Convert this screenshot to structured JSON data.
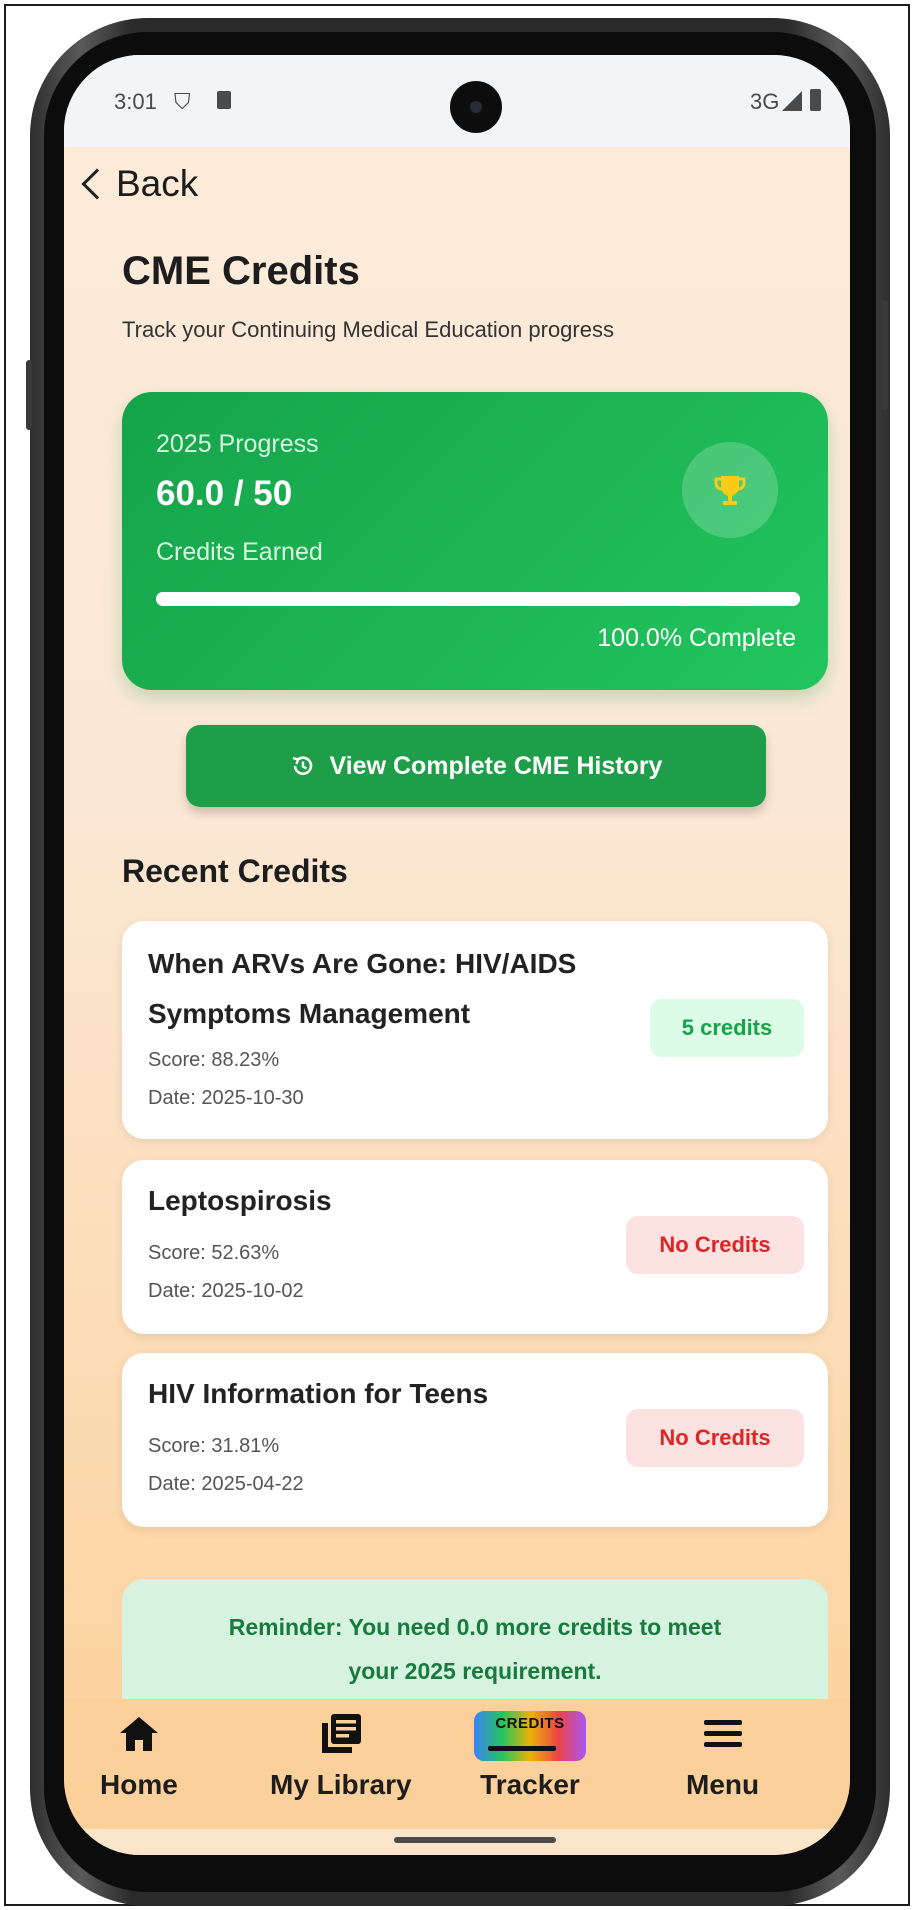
{
  "status_bar": {
    "time": "3:01",
    "network": "3G"
  },
  "nav": {
    "back_label": "Back"
  },
  "header": {
    "title": "CME Credits",
    "subtitle": "Track your Continuing Medical Education progress"
  },
  "progress_card": {
    "year_label": "2025 Progress",
    "value": "60.0 / 50",
    "earned_label": "Credits Earned",
    "progress_fraction": 1.0,
    "complete_label": "100.0% Complete",
    "icon": "trophy-icon"
  },
  "history_button": {
    "label": "View Complete CME History",
    "icon": "history-icon"
  },
  "recent": {
    "title": "Recent Credits",
    "items": [
      {
        "title_lines": [
          "When ARVs Are Gone: HIV/AIDS",
          "Symptoms Management"
        ],
        "score": "Score: 88.23%",
        "date": "Date: 2025-10-30",
        "badge": "5 credits",
        "status": "earned"
      },
      {
        "title_lines": [
          "Leptospirosis"
        ],
        "score": "Score: 52.63%",
        "date": "Date: 2025-10-02",
        "badge": "No Credits",
        "status": "none"
      },
      {
        "title_lines": [
          "HIV Information for Teens"
        ],
        "score": "Score: 31.81%",
        "date": "Date: 2025-04-22",
        "badge": "No Credits",
        "status": "none"
      }
    ]
  },
  "reminder": {
    "line1": "Reminder: You need 0.0 more credits to meet",
    "line2": "your 2025 requirement."
  },
  "bottom_nav": {
    "home": "Home",
    "library": "My Library",
    "tracker": "Tracker",
    "tracker_icon_text": "CREDITS",
    "menu": "Menu"
  },
  "colors": {
    "accent_green": "#16a34a",
    "badge_green_bg": "#dcfce7",
    "badge_red_bg": "#fde2e2",
    "badge_red_text": "#dc2626",
    "trophy": "#facc15"
  }
}
